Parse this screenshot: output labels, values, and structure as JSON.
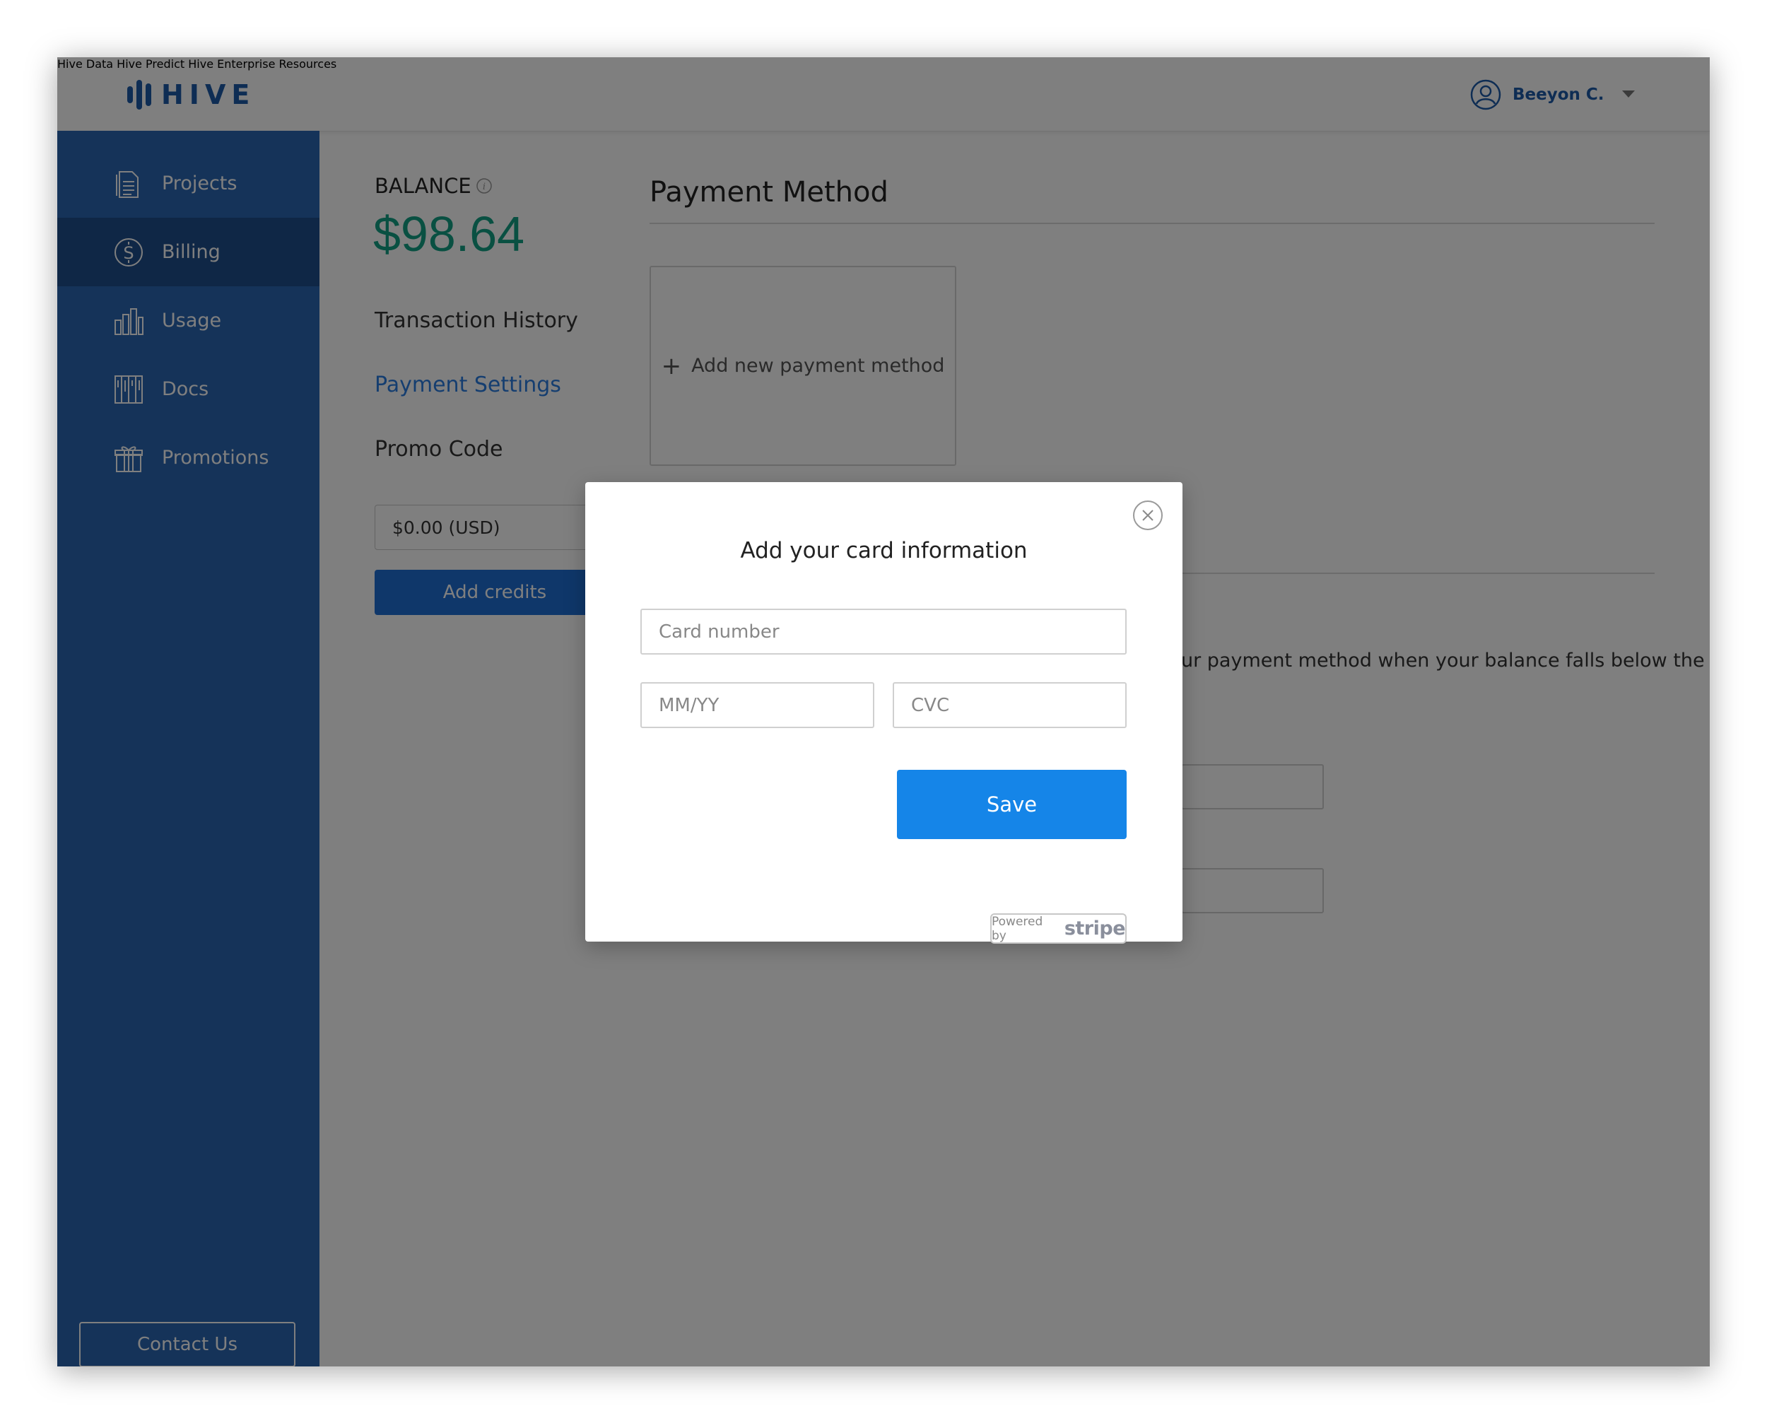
{
  "header": {
    "logo_text": "HIVE",
    "nav": [
      "Hive Data",
      "Hive Predict",
      "Hive Enterprise",
      "Resources"
    ],
    "user_name": "Beeyon C."
  },
  "sidebar": {
    "items": [
      {
        "label": "Projects",
        "icon": "document-icon",
        "active": false
      },
      {
        "label": "Billing",
        "icon": "dollar-circle-icon",
        "active": true
      },
      {
        "label": "Usage",
        "icon": "bar-chart-icon",
        "active": false
      },
      {
        "label": "Docs",
        "icon": "docs-columns-icon",
        "active": false
      },
      {
        "label": "Promotions",
        "icon": "gift-icon",
        "active": false
      }
    ],
    "contact_label": "Contact Us"
  },
  "billing": {
    "balance_label": "BALANCE",
    "balance_amount": "$98.64",
    "menu": [
      {
        "label": "Transaction History",
        "active": false
      },
      {
        "label": "Payment Settings",
        "active": true
      },
      {
        "label": "Promo Code",
        "active": false
      }
    ],
    "credit_value": "$0.00 (USD)",
    "add_credits_label": "Add credits"
  },
  "payment_method": {
    "title": "Payment Method",
    "add_new_label": "Add new payment method",
    "autopay_partial_text": "ur payment method when your balance falls below the set"
  },
  "modal": {
    "title": "Add your card information",
    "card_number_placeholder": "Card number",
    "expiry_placeholder": "MM/YY",
    "cvc_placeholder": "CVC",
    "save_label": "Save",
    "powered_by_prefix": "Powered by",
    "powered_by_brand": "stripe"
  },
  "colors": {
    "brand_blue": "#2a66b3",
    "sidebar_active": "#1f4f8c",
    "balance_green": "#12a184",
    "link_blue": "#2a7de1",
    "save_button": "#1585e8"
  }
}
